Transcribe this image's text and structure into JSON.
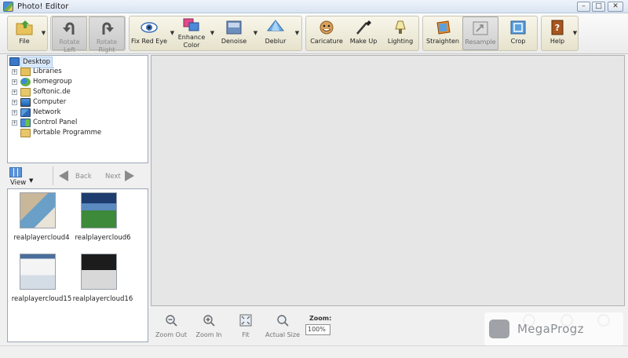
{
  "window": {
    "title": "Photo! Editor"
  },
  "toolbar": {
    "file": "File",
    "rotate_left": "Rotate Left",
    "rotate_right": "Rotate Right",
    "fix_red_eye": "Fix Red Eye",
    "enhance_color_line1": "Enhance",
    "enhance_color_line2": "Color",
    "denoise": "Denoise",
    "deblur": "Deblur",
    "caricature": "Caricature",
    "make_up": "Make Up",
    "lighting": "Lighting",
    "straighten": "Straighten",
    "resample": "Resample",
    "crop": "Crop",
    "help": "Help"
  },
  "tree": {
    "items": [
      {
        "label": "Desktop"
      },
      {
        "label": "Libraries"
      },
      {
        "label": "Homegroup"
      },
      {
        "label": "Softonic.de"
      },
      {
        "label": "Computer"
      },
      {
        "label": "Network"
      },
      {
        "label": "Control Panel"
      },
      {
        "label": "Portable Programme"
      }
    ]
  },
  "nav": {
    "view": "View",
    "back": "Back",
    "next": "Next"
  },
  "thumbnails": [
    {
      "name": "realplayercloud4"
    },
    {
      "name": "realplayercloud6"
    },
    {
      "name": "realplayercloud15"
    },
    {
      "name": "realplayercloud16"
    }
  ],
  "zoom": {
    "zoom_out": "Zoom Out",
    "zoom_in": "Zoom In",
    "fit": "Fit",
    "actual_size": "Actual Size",
    "label": "Zoom:",
    "value": "100%"
  },
  "watermark": {
    "text": "MegaProgz"
  },
  "colors": {
    "group_bg": "#ece8d4",
    "preview_bg": "#e6e6e6",
    "selection": "#d8e8fb"
  }
}
